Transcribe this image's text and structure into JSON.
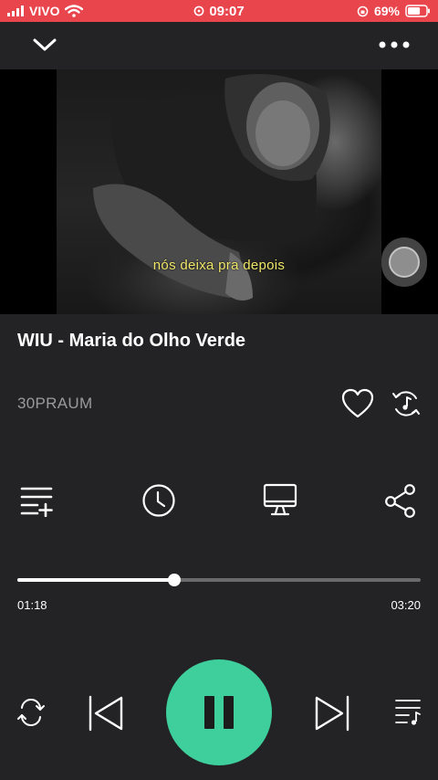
{
  "status_bar": {
    "carrier": "VIVO",
    "time": "09:07",
    "battery": "69%",
    "icons": [
      "signal-icon",
      "wifi-icon",
      "alarm-icon",
      "orientation-lock-icon",
      "battery-icon"
    ],
    "battery_level": 0.69,
    "background": "#e8454c"
  },
  "video": {
    "subtitle": "nós deixa pra depois"
  },
  "track": {
    "title": "WIU - Maria do Olho Verde",
    "artist": "30PRAUM"
  },
  "playback": {
    "elapsed": "01:18",
    "duration": "03:20",
    "progress": 0.39,
    "state": "playing"
  },
  "colors": {
    "accent": "#3ecf9c",
    "background": "#232325",
    "subtitle": "#f0e66a",
    "artist_text": "#9a9a9a"
  },
  "icons": {
    "top": [
      "chevron-down-icon",
      "more-icon"
    ],
    "track_actions": [
      "heart-icon",
      "music-sync-icon"
    ],
    "tools": [
      "add-to-queue-icon",
      "clock-icon",
      "monitor-icon",
      "share-icon"
    ],
    "controls": [
      "repeat-icon",
      "previous-icon",
      "pause-icon",
      "next-icon",
      "queue-icon"
    ]
  }
}
